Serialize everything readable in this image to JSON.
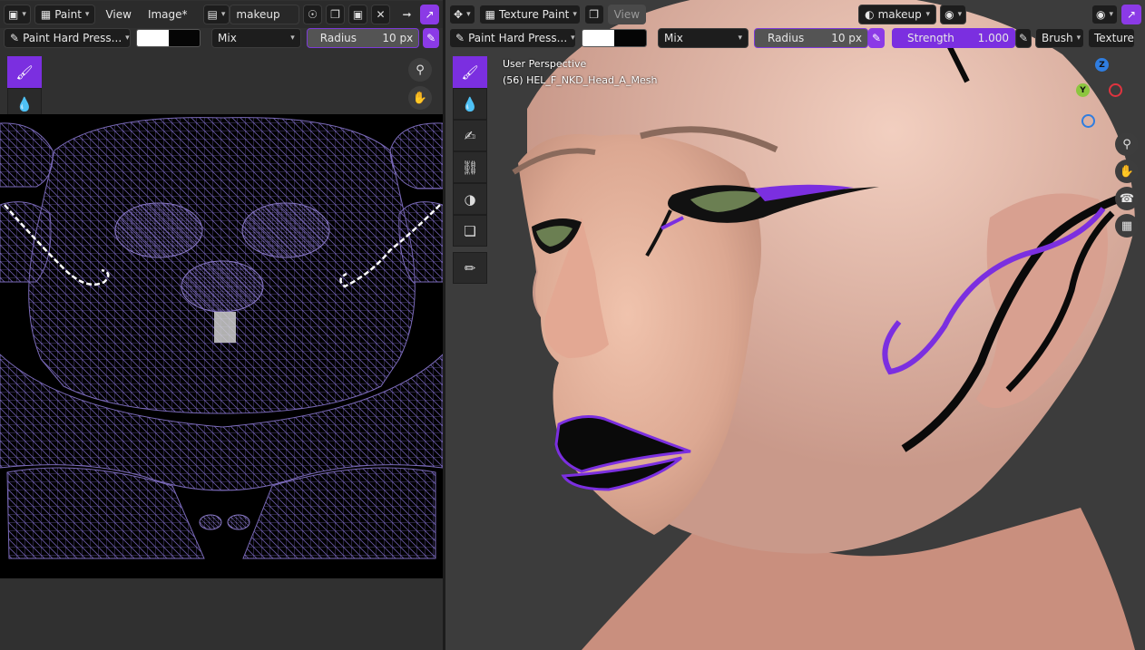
{
  "left_header": {
    "editor_type": "▣",
    "mode_label": "Paint",
    "menu_view": "View",
    "menu_image": "Image*",
    "image_name": "makeup"
  },
  "left_tool_settings": {
    "brush_name": "Paint Hard Press...",
    "color_primary": "#ffffff",
    "color_secondary": "#050505",
    "blend_mode": "Mix",
    "radius_label": "Radius",
    "radius_value": "10 px"
  },
  "right_header": {
    "mode_label": "Texture Paint",
    "menu_view": "View",
    "material_name": "makeup"
  },
  "right_tool_settings": {
    "brush_name": "Paint Hard Press...",
    "color_primary": "#ffffff",
    "color_secondary": "#050505",
    "blend_mode": "Mix",
    "radius_label": "Radius",
    "radius_value": "10 px",
    "strength_label": "Strength",
    "strength_value": "1.000",
    "brush_menu": "Brush",
    "texture_menu": "Texture"
  },
  "viewport_overlay": {
    "perspective": "User Perspective",
    "object_info": "(56) HEL_F_NKD_Head_A_Mesh"
  },
  "gizmo": {
    "z": "Z",
    "y": "Y"
  },
  "colors": {
    "accent": "#7b2fe0",
    "wire": "#6a5aa8",
    "skin": "#e6b29d"
  },
  "tools": [
    "brush-icon",
    "blur-icon",
    "smear-icon",
    "clone-icon",
    "fill-icon",
    "mask-icon",
    "annotate-icon"
  ]
}
